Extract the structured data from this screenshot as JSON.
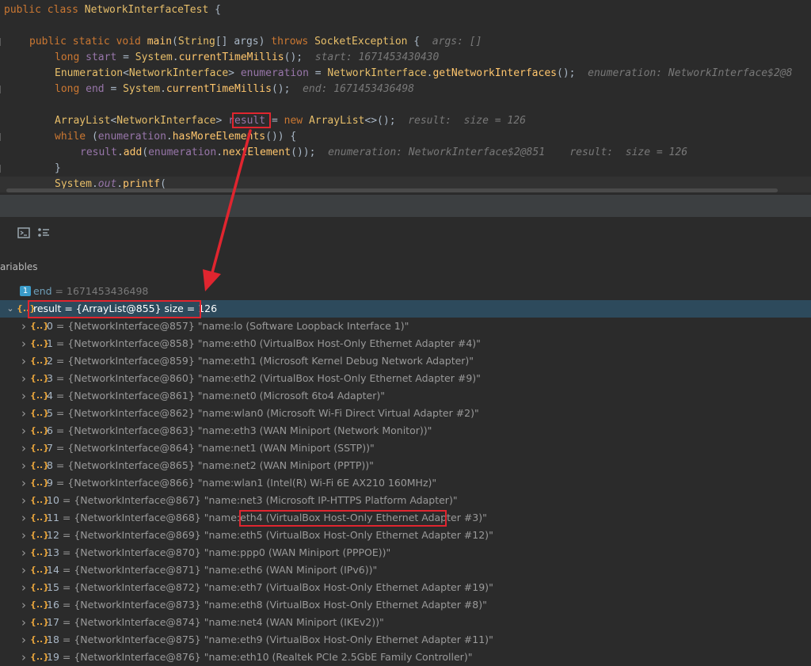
{
  "editor": {
    "line1": {
      "kw": "public class ",
      "cls": "NetworkInterfaceTest",
      "rest": " {"
    },
    "line2": {
      "kw1": "public static void ",
      "fn": "main",
      "p1": "(",
      "type": "String",
      "p2": "[] ",
      "arg": "args",
      "p3": ") ",
      "kw2": "throws ",
      "exc": "SocketException",
      "p4": " {",
      "hint": "args: []"
    },
    "line3": {
      "kw": "long ",
      "v": "start",
      "eq": " = ",
      "cls": "System",
      "dot": ".",
      "fn": "currentTimeMillis",
      "end": "();",
      "hint": "start: 1671453430430"
    },
    "line4": {
      "cls": "Enumeration",
      "lt": "<",
      "gen": "NetworkInterface",
      "gt": "> ",
      "v": "enumeration",
      "eq": " = ",
      "cls2": "NetworkInterface",
      "dot": ".",
      "fn": "getNetworkInterfaces",
      "end": "();",
      "hint": "enumeration: NetworkInterface$2@8"
    },
    "line5": {
      "kw": "long ",
      "v": "end",
      "eq": " = ",
      "cls": "System",
      "dot": ".",
      "fn": "currentTimeMillis",
      "end": "();",
      "hint": "end: 1671453436498"
    },
    "line6": {
      "cls": "ArrayList",
      "lt": "<",
      "gen": "NetworkInterface",
      "gt": "> ",
      "v": "result",
      "eq": " = ",
      "kw": "new ",
      "cls2": "ArrayList",
      "diamond": "<>",
      "end": "();",
      "hint": "result:  size = 126"
    },
    "line7": {
      "kw": "while ",
      "p1": "(",
      "v": "enumeration",
      "dot": ".",
      "fn": "hasMoreElements",
      "end": "()) {"
    },
    "line8": {
      "v": "result",
      "dot": ".",
      "fn": "add",
      "p1": "(",
      "v2": "enumeration",
      "dot2": ".",
      "fn2": "nextElement",
      "end": "());",
      "hint": "enumeration: NetworkInterface$2@851    result:  size = 126"
    },
    "line9": {
      "brace": "}"
    },
    "line10": {
      "cls": "System",
      "dot": ".",
      "out": "out",
      "dot2": ".",
      "fn": "printf",
      "end": "("
    }
  },
  "debug": {
    "variables_title": "ariables",
    "end_var": {
      "name": "end",
      "value": "= 1671453436498"
    },
    "result_var": {
      "text": "result = {ArrayList@855}  size = 126"
    },
    "items": [
      {
        "idx": "0",
        "text": " = {NetworkInterface@857} \"name:lo (Software Loopback Interface 1)\""
      },
      {
        "idx": "1",
        "text": " = {NetworkInterface@858} \"name:eth0 (VirtualBox Host-Only Ethernet Adapter #4)\""
      },
      {
        "idx": "2",
        "text": " = {NetworkInterface@859} \"name:eth1 (Microsoft Kernel Debug Network Adapter)\""
      },
      {
        "idx": "3",
        "text": " = {NetworkInterface@860} \"name:eth2 (VirtualBox Host-Only Ethernet Adapter #9)\""
      },
      {
        "idx": "4",
        "text": " = {NetworkInterface@861} \"name:net0 (Microsoft 6to4 Adapter)\""
      },
      {
        "idx": "5",
        "text": " = {NetworkInterface@862} \"name:wlan0 (Microsoft Wi-Fi Direct Virtual Adapter #2)\""
      },
      {
        "idx": "6",
        "text": " = {NetworkInterface@863} \"name:eth3 (WAN Miniport (Network Monitor))\""
      },
      {
        "idx": "7",
        "text": " = {NetworkInterface@864} \"name:net1 (WAN Miniport (SSTP))\""
      },
      {
        "idx": "8",
        "text": " = {NetworkInterface@865} \"name:net2 (WAN Miniport (PPTP))\""
      },
      {
        "idx": "9",
        "text": " = {NetworkInterface@866} \"name:wlan1 (Intel(R) Wi-Fi 6E AX210 160MHz)\""
      },
      {
        "idx": "10",
        "text": " = {NetworkInterface@867} \"name:net3 (Microsoft IP-HTTPS Platform Adapter)\""
      },
      {
        "idx": "11",
        "text": " = {NetworkInterface@868} \"name:eth4",
        "highlight": " (VirtualBox Host-Only Ethernet Adapter #3)\""
      },
      {
        "idx": "12",
        "text": " = {NetworkInterface@869} \"name:eth5 (VirtualBox Host-Only Ethernet Adapter #12)\""
      },
      {
        "idx": "13",
        "text": " = {NetworkInterface@870} \"name:ppp0 (WAN Miniport (PPPOE))\""
      },
      {
        "idx": "14",
        "text": " = {NetworkInterface@871} \"name:eth6 (WAN Miniport (IPv6))\""
      },
      {
        "idx": "15",
        "text": " = {NetworkInterface@872} \"name:eth7 (VirtualBox Host-Only Ethernet Adapter #19)\""
      },
      {
        "idx": "16",
        "text": " = {NetworkInterface@873} \"name:eth8 (VirtualBox Host-Only Ethernet Adapter #8)\""
      },
      {
        "idx": "17",
        "text": " = {NetworkInterface@874} \"name:net4 (WAN Miniport (IKEv2))\""
      },
      {
        "idx": "18",
        "text": " = {NetworkInterface@875} \"name:eth9 (VirtualBox Host-Only Ethernet Adapter #11)\""
      },
      {
        "idx": "19",
        "text": " = {NetworkInterface@876} \"name:eth10 (Realtek PCIe 2.5GbE Family Controller)\""
      }
    ]
  }
}
